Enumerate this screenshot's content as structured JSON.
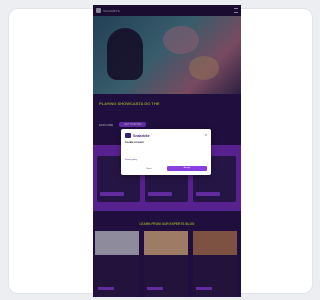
{
  "header": {
    "brand": "SNAKEBITE"
  },
  "hero": {
    "title": "PLAYING SHOWCASTA DO THE",
    "copy": "",
    "link_label": "EXPLORE",
    "cta_label": "GET STARTED"
  },
  "features": [
    {
      "title": ""
    },
    {
      "title": ""
    },
    {
      "title": ""
    }
  ],
  "section": {
    "title": "LEARN FROM OUR EXPERTS BLOG"
  },
  "articles": [
    {
      "title": ""
    },
    {
      "title": ""
    },
    {
      "title": ""
    }
  ],
  "modal": {
    "brand": "Snakebite",
    "heading": "Cookie consent",
    "body": "",
    "link": "Privacy policy",
    "reject_label": "Reject",
    "accept_label": "Accept"
  },
  "colors": {
    "page_bg": "#26124a",
    "accent_lime": "#cde92d",
    "accent_purple": "#8a3fe0"
  }
}
